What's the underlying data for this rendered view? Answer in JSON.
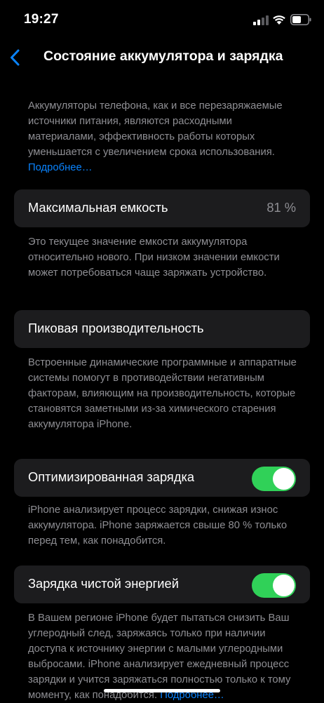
{
  "status_bar": {
    "time": "19:27",
    "icons": [
      "signal-icon",
      "wifi-icon",
      "battery-icon"
    ]
  },
  "nav": {
    "back_icon": "chevron-left-icon",
    "title": "Состояние аккумулятора и зарядка"
  },
  "intro": {
    "text": "Аккумуляторы телефона, как и все перезаряжаемые источники питания, являются расходными материалами, эффективность работы которых уменьшается с увеличением срока использования.",
    "link": "Подробнее…"
  },
  "max_capacity": {
    "label": "Максимальная емкость",
    "value": "81 %",
    "description": "Это текущее значение емкости аккумулятора относительно нового. При низком значении емкости может потребоваться чаще заряжать устройство."
  },
  "peak_performance": {
    "label": "Пиковая производительность",
    "description": "Встроенные динамические программные и аппаратные системы помогут в противодействии негативным факторам, влияющим на производительность, которые становятся заметными из-за химического старения аккумулятора iPhone."
  },
  "optimized_charging": {
    "label": "Оптимизированная зарядка",
    "enabled": true,
    "description": "iPhone анализирует процесс зарядки, снижая износ аккумулятора. iPhone заряжается свыше 80 % только перед тем, как понадобится."
  },
  "clean_energy_charging": {
    "label": "Зарядка чистой энергией",
    "enabled": true,
    "description": "В Вашем регионе iPhone будет пытаться снизить Ваш углеродный след, заряжаясь только при наличии доступа к источнику энергии с малыми углеродными выбросами. iPhone анализирует ежедневный процесс зарядки и учится заряжаться полностью только к тому моменту, как понадобится.",
    "link": "Подробнее…"
  },
  "colors": {
    "background": "#000000",
    "card": "#1c1c1e",
    "secondary_text": "#8e8e93",
    "link": "#0a84ff",
    "toggle_on": "#30d158"
  }
}
